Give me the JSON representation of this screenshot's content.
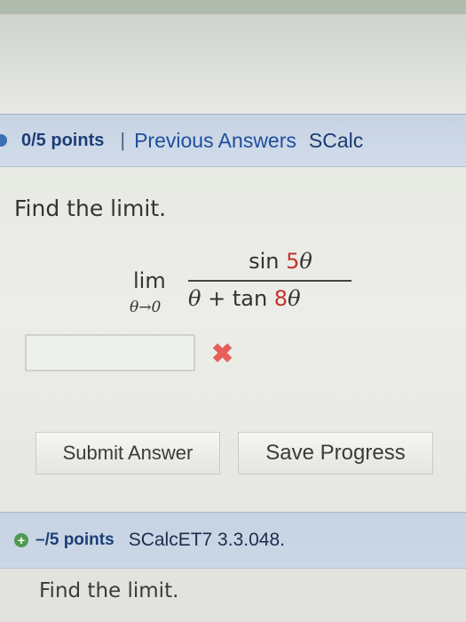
{
  "question1": {
    "points": "0/5 points",
    "separator": "|",
    "previous_answers_link": "Previous Answers",
    "course_code": "SCalc",
    "prompt": "Find the limit.",
    "limit": {
      "operator": "lim",
      "subscript": "θ→0",
      "numerator_func": "sin ",
      "numerator_coef": "5",
      "numerator_var": "θ",
      "denominator_var": "θ",
      "denominator_plus": " + tan ",
      "denominator_coef": "8",
      "denominator_var2": "θ"
    },
    "answer_value": "",
    "result_mark": "✖"
  },
  "buttons": {
    "submit_label": "Submit Answer",
    "save_label": "Save Progress"
  },
  "question2": {
    "expand_icon": "+",
    "points": "–/5 points",
    "course_code": "SCalcET7 3.3.048.",
    "prompt": "Find the limit."
  },
  "colors": {
    "header_bg": "#c9d5e4",
    "link_blue": "#1f4f9c",
    "accent_red": "#c4342b",
    "wrong_mark": "#e5605a"
  }
}
